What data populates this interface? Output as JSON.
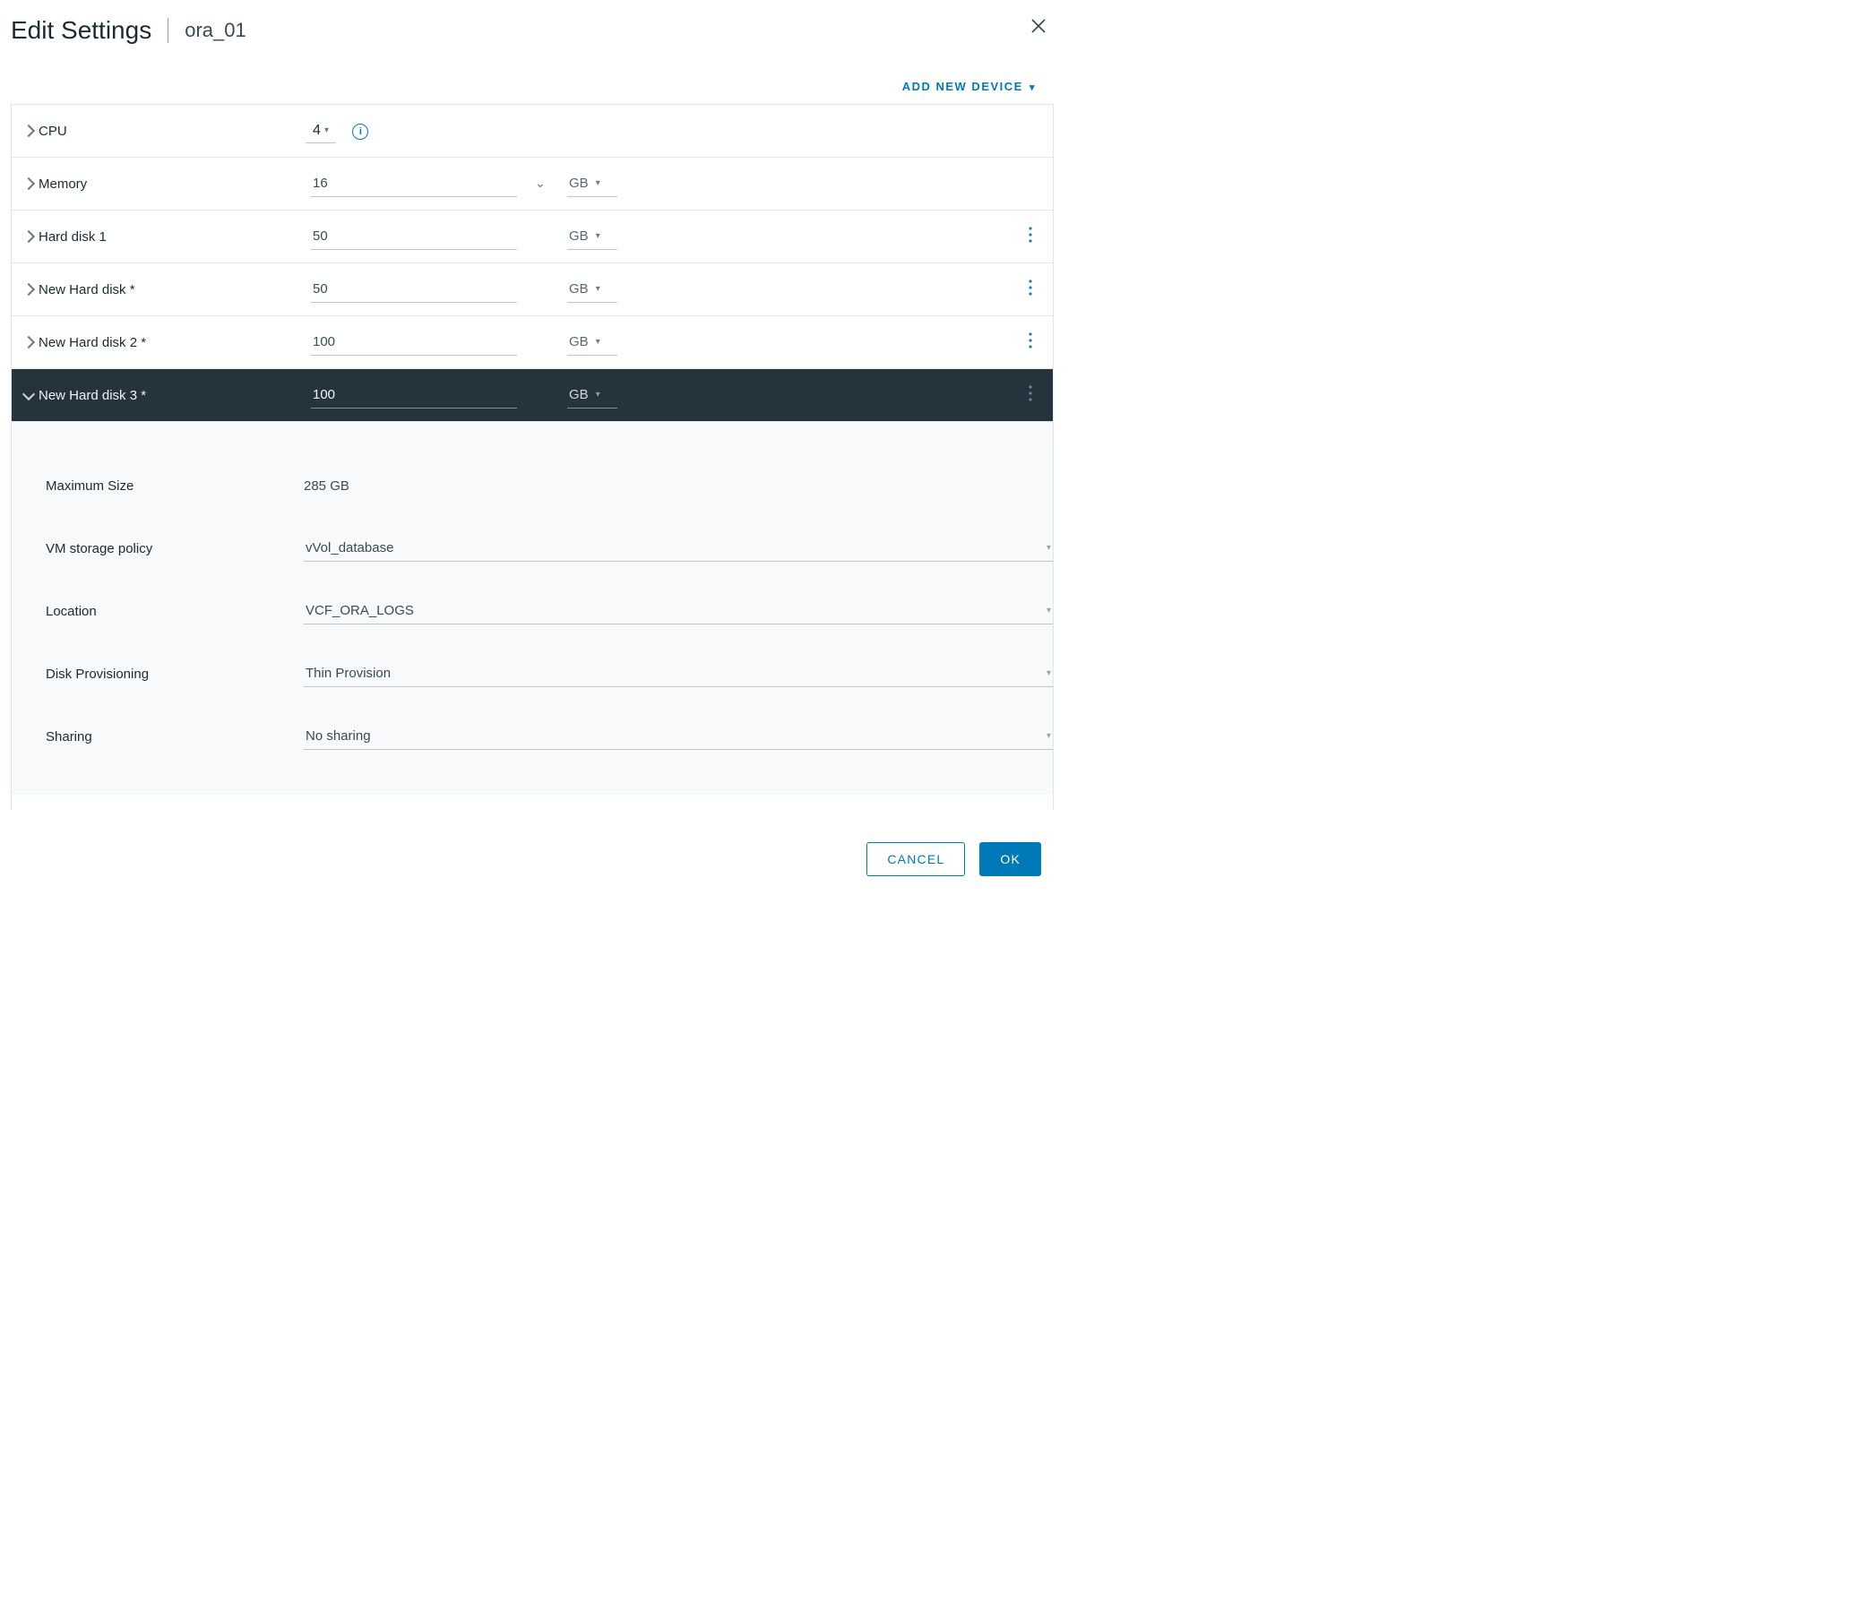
{
  "header": {
    "title": "Edit Settings",
    "subtitle": "ora_01"
  },
  "toolbar": {
    "add_device": "ADD NEW DEVICE"
  },
  "hw": {
    "cpu": {
      "label": "CPU",
      "value": "4"
    },
    "memory": {
      "label": "Memory",
      "value": "16",
      "unit": "GB"
    },
    "hd1": {
      "label": "Hard disk 1",
      "value": "50",
      "unit": "GB"
    },
    "nhd1": {
      "label": "New Hard disk *",
      "value": "50",
      "unit": "GB"
    },
    "nhd2": {
      "label": "New Hard disk 2 *",
      "value": "100",
      "unit": "GB"
    },
    "nhd3": {
      "label": "New Hard disk 3 *",
      "value": "100",
      "unit": "GB"
    }
  },
  "detail": {
    "max_size": {
      "label": "Maximum Size",
      "value": "285 GB"
    },
    "policy": {
      "label": "VM storage policy",
      "value": "vVol_database"
    },
    "location": {
      "label": "Location",
      "value": "VCF_ORA_LOGS"
    },
    "provisioning": {
      "label": "Disk Provisioning",
      "value": "Thin Provision"
    },
    "sharing": {
      "label": "Sharing",
      "value": "No sharing"
    }
  },
  "footer": {
    "cancel": "CANCEL",
    "ok": "OK"
  }
}
